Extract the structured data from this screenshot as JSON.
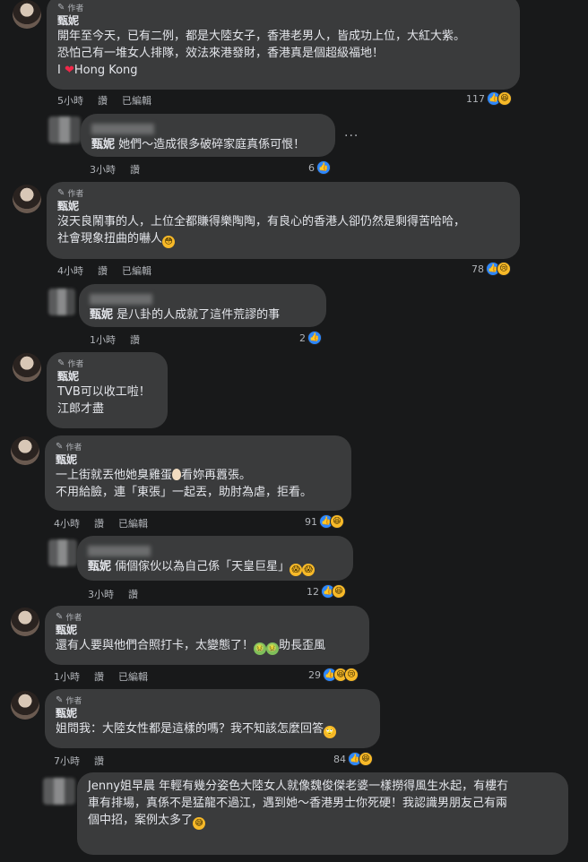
{
  "author_badge": "作者",
  "comments": [
    {
      "name": "甄妮",
      "text": "開年至今天，已有二例，都是大陸女子，香港老男人，皆成功上位，大紅大紫。\n恐怕己有一堆女人排隊，效法來港發財，香港真是個超級福地！\nI ",
      "text_tail": "Hong Kong",
      "time": "5小時",
      "reply": "讚",
      "edited": "已編輯",
      "count": "117"
    },
    {
      "name": "甄妮",
      "text": "她們～造成很多破碎家庭真係可恨！",
      "time": "3小時",
      "reply": "讚",
      "count": "6"
    },
    {
      "name": "甄妮",
      "text": "沒天良鬧事的人，上位全都賺得樂陶陶，有良心的香港人卻仍然是剩得苦哈哈，\n社會現象扭曲的嚇人",
      "time": "4小時",
      "reply": "讚",
      "edited": "已編輯",
      "count": "78"
    },
    {
      "name": "甄妮",
      "text": "是八卦的人成就了這件荒謬的事",
      "time": "1小時",
      "reply": "讚",
      "count": "2"
    },
    {
      "name": "甄妮",
      "text": "TVB可以收工啦！\n江郎才盡"
    },
    {
      "name": "甄妮",
      "text_a": "一上街就丟他她臭雞蛋",
      "text_b": "看妳再囂張。\n不用給臉，連「東張」一起丟，助肘為虐，拒看。",
      "time": "4小時",
      "reply": "讚",
      "edited": "已編輯",
      "count": "91"
    },
    {
      "name": "甄妮",
      "text": "倆個傢伙以為自己係「天皇巨星」",
      "time": "3小時",
      "reply": "讚",
      "count": "12"
    },
    {
      "name": "甄妮",
      "text": "還有人要與他們合照打卡，太變態了！",
      "text_tail": "助長歪風",
      "time": "1小時",
      "reply": "讚",
      "edited": "已編輯",
      "count": "29"
    },
    {
      "name": "甄妮",
      "text": "姐問我：大陸女性都是這樣的嗎？我不知該怎麼回答",
      "time": "7小時",
      "reply": "讚",
      "count": "84"
    },
    {
      "text": "Jenny姐早晨 年輕有幾分姿色大陸女人就像魏俊傑老婆一樣撈得風生水起，有樓冇\n車有排場，真係不是猛龍不過江，遇到她～香港男士你死硬！我認識男朋友己有兩\n個中招，案例太多了"
    }
  ],
  "more_options": "···"
}
